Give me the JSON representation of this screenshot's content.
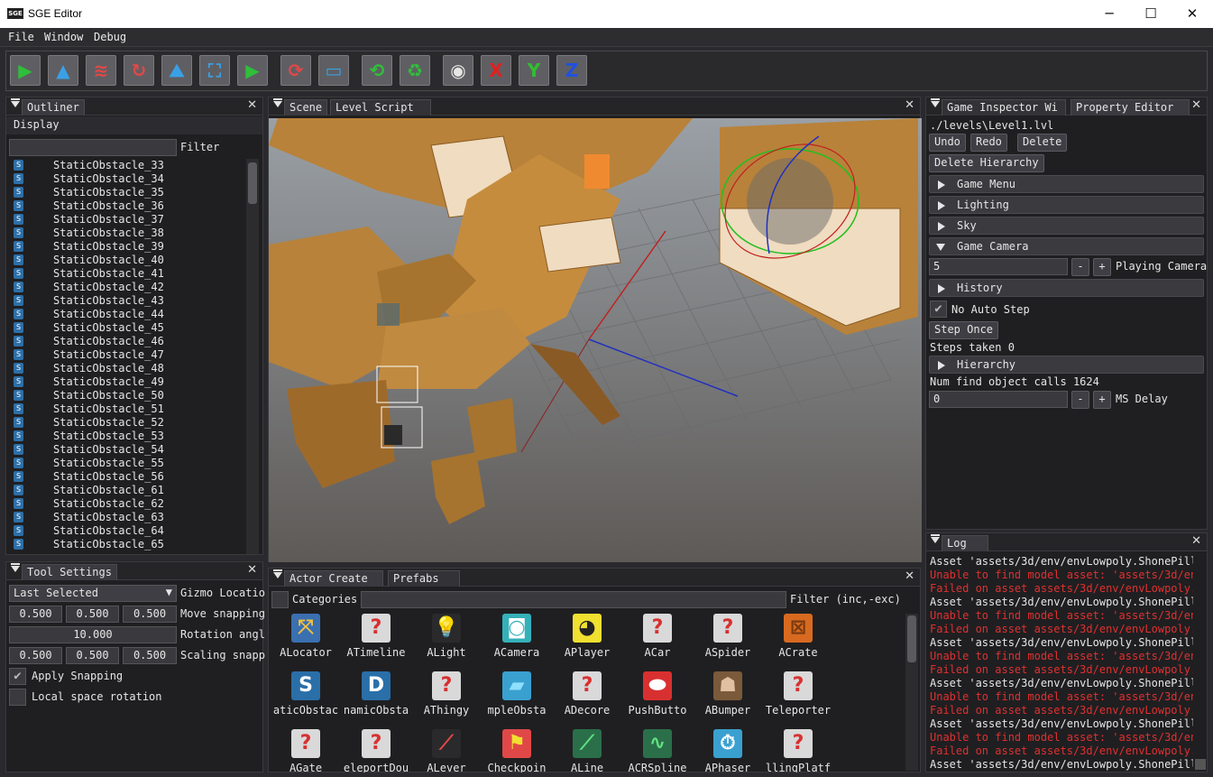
{
  "window": {
    "logo": "SGE",
    "title": "SGE Editor",
    "minimize": "─",
    "maximize": "☐",
    "close": "✕"
  },
  "menu": [
    "File",
    "Window",
    "Debug"
  ],
  "toolbar": [
    {
      "name": "play-icon",
      "glyph": "▶",
      "color": "#2fbf3a"
    },
    {
      "name": "terrain-icon",
      "glyph": "▲",
      "color": "#3aa0e6"
    },
    {
      "name": "landscape-icon",
      "glyph": "≋",
      "color": "#e04848"
    },
    {
      "name": "rotate-icon",
      "glyph": "↻",
      "color": "#e04848"
    },
    {
      "name": "mountains-icon",
      "glyph": "⛰",
      "color": "#3aa0e6"
    },
    {
      "name": "frame-icon",
      "glyph": "⛶",
      "color": "#3aa0e6"
    },
    {
      "name": "play-add-icon",
      "glyph": "▶",
      "color": "#2fbf3a"
    },
    {
      "name": "refresh-object-icon",
      "glyph": "⟳",
      "color": "#e04848"
    },
    {
      "name": "window-icon",
      "glyph": "▭",
      "color": "#3aa0e6"
    },
    {
      "name": "reload-icon",
      "glyph": "⟲",
      "color": "#2fbf3a"
    },
    {
      "name": "cycle-icon",
      "glyph": "♻",
      "color": "#2fbf3a"
    },
    {
      "name": "camera-icon",
      "glyph": "◉",
      "color": "#e6e6e6"
    },
    {
      "name": "axis-x-icon",
      "glyph": "X",
      "color": "#e02020"
    },
    {
      "name": "axis-y-icon",
      "glyph": "Y",
      "color": "#30c030"
    },
    {
      "name": "axis-z-icon",
      "glyph": "Z",
      "color": "#2050e0"
    }
  ],
  "outliner": {
    "tab": "Outliner",
    "display": "Display",
    "filter_label": "Filter",
    "items": [
      "StaticObstacle_33",
      "StaticObstacle_34",
      "StaticObstacle_35",
      "StaticObstacle_36",
      "StaticObstacle_37",
      "StaticObstacle_38",
      "StaticObstacle_39",
      "StaticObstacle_40",
      "StaticObstacle_41",
      "StaticObstacle_42",
      "StaticObstacle_43",
      "StaticObstacle_44",
      "StaticObstacle_45",
      "StaticObstacle_46",
      "StaticObstacle_47",
      "StaticObstacle_48",
      "StaticObstacle_49",
      "StaticObstacle_50",
      "StaticObstacle_51",
      "StaticObstacle_52",
      "StaticObstacle_53",
      "StaticObstacle_54",
      "StaticObstacle_55",
      "StaticObstacle_56",
      "StaticObstacle_61",
      "StaticObstacle_62",
      "StaticObstacle_63",
      "StaticObstacle_64",
      "StaticObstacle_65"
    ]
  },
  "tool_settings": {
    "tab": "Tool Settings",
    "gizmo_select": "Last Selected",
    "gizmo_label": "Gizmo Locatio",
    "move": [
      "0.500",
      "0.500",
      "0.500"
    ],
    "move_label": "Move snapping",
    "rotation": "10.000",
    "rotation_label": "Rotation angl",
    "scale": [
      "0.500",
      "0.500",
      "0.500"
    ],
    "scale_label": "Scaling snapp",
    "apply_snapping": "Apply Snapping",
    "local_rotation": "Local space rotation"
  },
  "scene": {
    "tabs": [
      "Scene",
      "Level Script"
    ]
  },
  "actor_create": {
    "tabs": [
      "Actor Create",
      "Prefabs"
    ],
    "categories_label": "Categories",
    "filter_label": "Filter (inc,-exc)",
    "actors": [
      {
        "label": "ALocator",
        "glyph": "⤧",
        "bg": "#3a6fb0",
        "fg": "#f0c040"
      },
      {
        "label": "ATimeline",
        "glyph": "?",
        "bg": "#d9d9d9",
        "fg": "#d83030"
      },
      {
        "label": "ALight",
        "glyph": "💡",
        "bg": "#2a2a2c",
        "fg": "#f0e060"
      },
      {
        "label": "ACamera",
        "glyph": "◙",
        "bg": "#35b0b8",
        "fg": "#ffffff"
      },
      {
        "label": "APlayer",
        "glyph": "◕",
        "bg": "#f0e030",
        "fg": "#222222"
      },
      {
        "label": "ACar",
        "glyph": "?",
        "bg": "#d9d9d9",
        "fg": "#d83030"
      },
      {
        "label": "ASpider",
        "glyph": "?",
        "bg": "#d9d9d9",
        "fg": "#d83030"
      },
      {
        "label": "ACrate",
        "glyph": "⊠",
        "bg": "#d86a20",
        "fg": "#7a3a10"
      },
      {
        "label": "aticObstac",
        "glyph": "S",
        "bg": "#2a6fa8",
        "fg": "#ffffff"
      },
      {
        "label": "namicObsta",
        "glyph": "D",
        "bg": "#2a6fa8",
        "fg": "#ffffff"
      },
      {
        "label": "AThingy",
        "glyph": "?",
        "bg": "#d9d9d9",
        "fg": "#d83030"
      },
      {
        "label": "mpleObsta",
        "glyph": "▰",
        "bg": "#3aa0d0",
        "fg": "#8ee0ff"
      },
      {
        "label": "ADecore",
        "glyph": "?",
        "bg": "#d9d9d9",
        "fg": "#d83030"
      },
      {
        "label": "PushButto",
        "glyph": "⬬",
        "bg": "#d83030",
        "fg": "#ffffff"
      },
      {
        "label": "ABumper",
        "glyph": "☗",
        "bg": "#7a5a3a",
        "fg": "#e0c0a0"
      },
      {
        "label": "Teleporter",
        "glyph": "?",
        "bg": "#d9d9d9",
        "fg": "#d83030"
      },
      {
        "label": "AGate",
        "glyph": "?",
        "bg": "#d9d9d9",
        "fg": "#d83030"
      },
      {
        "label": "eleportDou",
        "glyph": "?",
        "bg": "#d9d9d9",
        "fg": "#d83030"
      },
      {
        "label": "ALever",
        "glyph": "⟋",
        "bg": "#2a2a2c",
        "fg": "#e04848"
      },
      {
        "label": "Checkpoin",
        "glyph": "⚑",
        "bg": "#e04848",
        "fg": "#f0e030"
      },
      {
        "label": "ALine",
        "glyph": "⟋",
        "bg": "#2a6f4a",
        "fg": "#60e080"
      },
      {
        "label": "ACRSpline",
        "glyph": "∿",
        "bg": "#2a6f4a",
        "fg": "#60e080"
      },
      {
        "label": "APhaser",
        "glyph": "⏱",
        "bg": "#3aa0d0",
        "fg": "#ffffff"
      },
      {
        "label": "llingPlatf",
        "glyph": "?",
        "bg": "#d9d9d9",
        "fg": "#d83030"
      }
    ]
  },
  "property_editor": {
    "tabs": [
      "Game Inspector Wi",
      "Property Editor"
    ],
    "path": "./levels\\Level1.lvl",
    "undo": "Undo",
    "redo": "Redo",
    "delete": "Delete",
    "delete_hierarchy": "Delete Hierarchy",
    "sections": [
      "Game Menu",
      "Lighting",
      "Sky",
      "Game Camera"
    ],
    "camera_value": "5",
    "minus": "-",
    "plus": "+",
    "camera_label": "Playing Camera",
    "history": "History",
    "no_auto_step": "No Auto Step",
    "step_once": "Step Once",
    "steps_taken": "Steps taken 0",
    "hierarchy": "Hierarchy",
    "find_calls": "Num find object calls 1624",
    "delay_value": "0",
    "delay_label": "MS Delay"
  },
  "log": {
    "tab": "Log",
    "lines": [
      {
        "text": "Asset 'assets/3d/env/envLowpoly.ShonePilla",
        "color": "#e6e6e6"
      },
      {
        "text": "Unable to find model asset: 'assets/3d/env",
        "color": "#e03030"
      },
      {
        "text": "Failed on asset assets/3d/env/envLowpoly.S",
        "color": "#e03030"
      },
      {
        "text": "Asset 'assets/3d/env/envLowpoly.ShonePilla",
        "color": "#e6e6e6"
      },
      {
        "text": "Unable to find model asset: 'assets/3d/env",
        "color": "#e03030"
      },
      {
        "text": "Failed on asset assets/3d/env/envLowpoly.S",
        "color": "#e03030"
      },
      {
        "text": "Asset 'assets/3d/env/envLowpoly.ShonePilla",
        "color": "#e6e6e6"
      },
      {
        "text": "Unable to find model asset: 'assets/3d/env",
        "color": "#e03030"
      },
      {
        "text": "Failed on asset assets/3d/env/envLowpoly.S",
        "color": "#e03030"
      },
      {
        "text": "Asset 'assets/3d/env/envLowpoly.ShonePilla",
        "color": "#e6e6e6"
      },
      {
        "text": "Unable to find model asset: 'assets/3d/env",
        "color": "#e03030"
      },
      {
        "text": "Failed on asset assets/3d/env/envLowpoly.S",
        "color": "#e03030"
      },
      {
        "text": "Asset 'assets/3d/env/envLowpoly.ShonePilla",
        "color": "#e6e6e6"
      },
      {
        "text": "Unable to find model asset: 'assets/3d/env",
        "color": "#e03030"
      },
      {
        "text": "Failed on asset assets/3d/env/envLowpoly.S",
        "color": "#e03030"
      },
      {
        "text": "Asset 'assets/3d/env/envLowpoly.ShonePilla",
        "color": "#e6e6e6"
      }
    ]
  }
}
